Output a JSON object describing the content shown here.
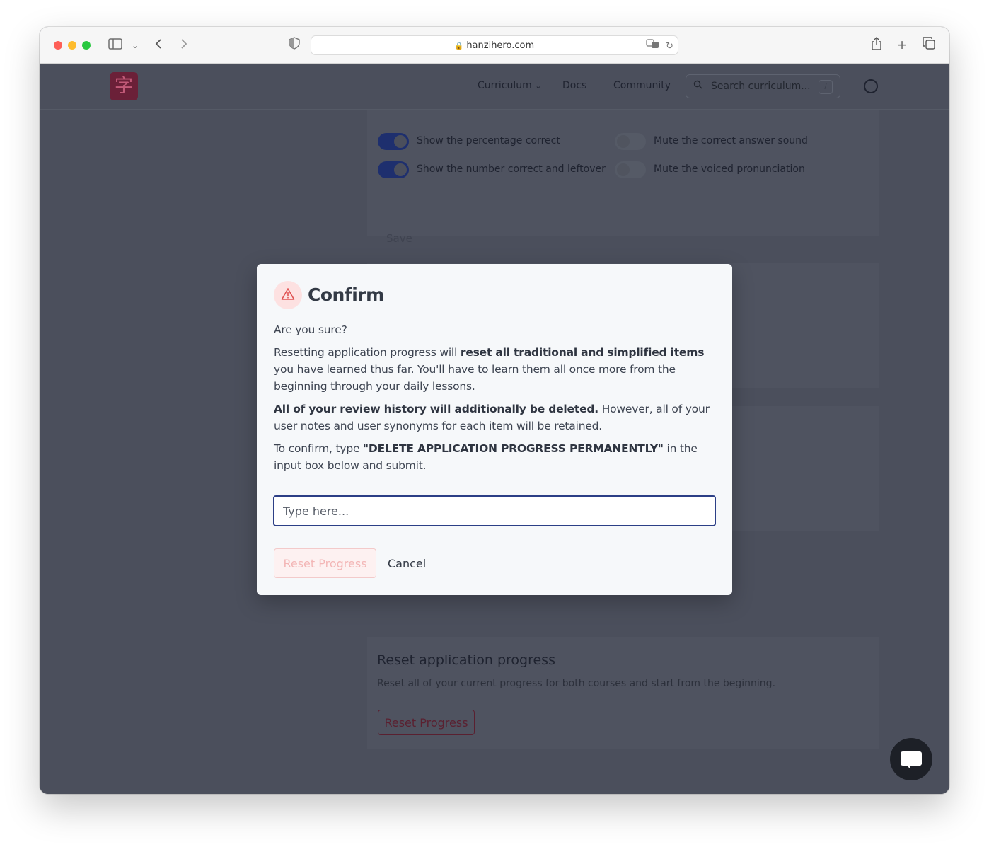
{
  "browser": {
    "url": "hanzihero.com"
  },
  "nav": {
    "logo_char": "字",
    "links": [
      "Curriculum",
      "Docs",
      "Community"
    ],
    "curriculum_chevron": "⌄",
    "search_placeholder": "Search curriculum...",
    "search_shortcut": "/"
  },
  "settings": {
    "options": [
      {
        "label": "Show the percentage correct",
        "on": true
      },
      {
        "label": "Show the number correct and leftover",
        "on": true
      },
      {
        "label": "Mute the correct answer sound",
        "on": false
      },
      {
        "label": "Mute the voiced pronunciation",
        "on": false
      }
    ],
    "save_label": "Save"
  },
  "reset_section": {
    "title": "Reset application progress",
    "description": "Reset all of your current progress for both courses and start from the beginning.",
    "button_label": "Reset Progress"
  },
  "modal": {
    "title": "Confirm",
    "question": "Are you sure?",
    "p1_start": "Resetting application progress will ",
    "p1_bold": "reset all traditional and simplified items",
    "p1_end": " you have learned thus far. You'll have to learn them all once more from the beginning through your daily lessons.",
    "p2_bold": "All of your review history will additionally be deleted.",
    "p2_end": " However, all of your user notes and user synonyms for each item will be retained.",
    "p3_start": "To confirm, type ",
    "p3_bold": "\"DELETE APPLICATION PROGRESS PERMANENTLY\"",
    "p3_end": " in the input box below and submit.",
    "input_placeholder": "Type here...",
    "input_value": "",
    "reset_label": "Reset Progress",
    "cancel_label": "Cancel"
  },
  "colors": {
    "overlay": "#4b4f5c",
    "modal_bg": "#f6f8fa",
    "accent_blue": "#2c3f86",
    "danger_light": "#fde1e1",
    "danger_icon": "#e05252"
  }
}
